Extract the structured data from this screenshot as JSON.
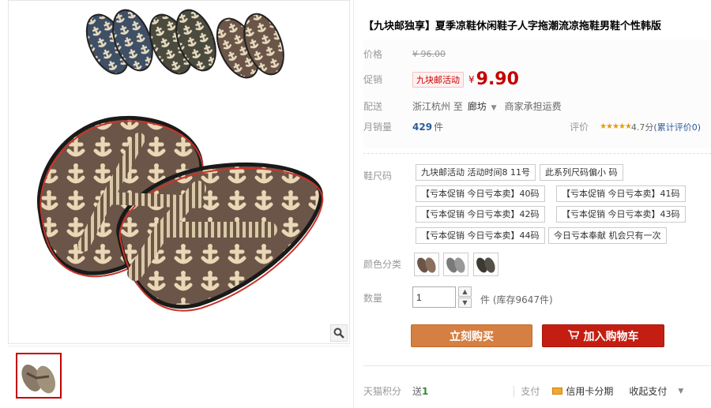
{
  "product": {
    "title": "【九块邮独享】夏季凉鞋休闲鞋子人字拖潮流凉拖鞋男鞋个性韩版"
  },
  "price": {
    "label": "价格",
    "original": "¥ 96.00"
  },
  "promo": {
    "label": "促销",
    "tag": "九块邮活动",
    "yen": "¥",
    "price": "9.90"
  },
  "shipping": {
    "label": "配送",
    "from": "浙江杭州 至",
    "to": "廊坊",
    "note": "商家承担运费"
  },
  "sales": {
    "label": "月销量",
    "count": "429",
    "unit": "件",
    "rating_label": "评价",
    "stars": "★★★★★",
    "score": "4.7分",
    "review_link": "(累计评价0)"
  },
  "sizes": {
    "label": "鞋尺码",
    "options": [
      "九块邮活动 活动时间8 11号",
      "此系列尺码偏小   码",
      "【亏本促销 今日亏本卖】40码",
      "【亏本促销 今日亏本卖】41码",
      "【亏本促销 今日亏本卖】42码",
      "【亏本促销 今日亏本卖】43码",
      "【亏本促销 今日亏本卖】44码",
      "今日亏本奉献 机会只有一次"
    ]
  },
  "color": {
    "label": "颜色分类"
  },
  "quantity": {
    "label": "数量",
    "value": "1",
    "stock": "件 (库存9647件)"
  },
  "actions": {
    "buy": "立刻购买",
    "cart": "加入购物车"
  },
  "footer": {
    "points_label": "天猫积分",
    "points_prefix": "送",
    "points_value": "1",
    "pay_label": "支付",
    "credit": "信用卡分期",
    "more": "收起支付"
  },
  "colors": {
    "accent": "#c40000",
    "buy_button": "#d57f42",
    "cart_button": "#c41e12",
    "link": "#2d5c9a"
  }
}
